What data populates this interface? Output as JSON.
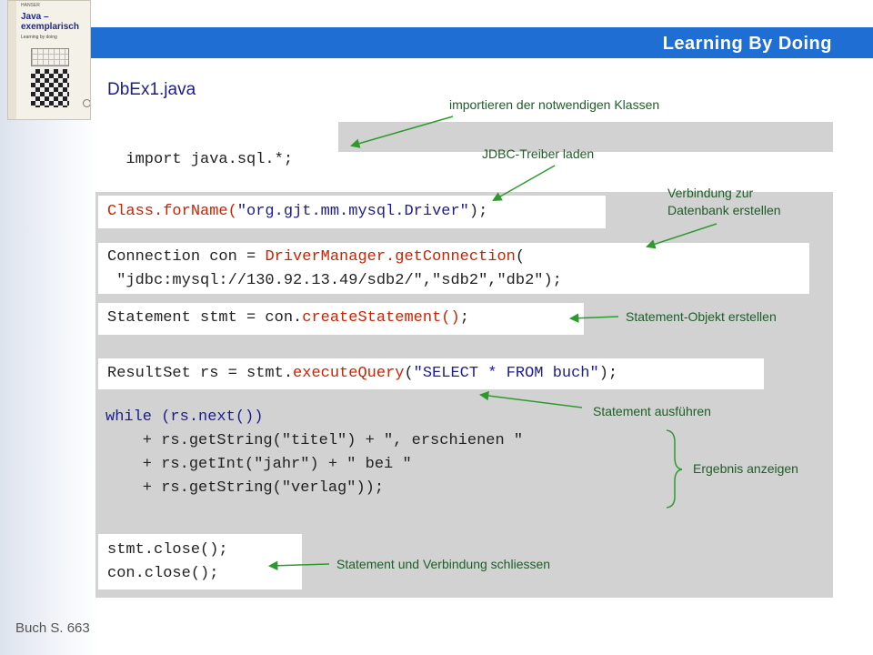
{
  "header": {
    "title": "Learning By Doing"
  },
  "book_cover": {
    "publisher": "HANSER",
    "title_line1": "Java –",
    "title_line2": "exemplarisch",
    "subtitle": "Learning by doing"
  },
  "file_name": "DbEx1.java",
  "code": {
    "import_line": "import java.sql.*;",
    "forname_prefix": "Class.forName(",
    "forname_string": "\"org.gjt.mm.mysql.Driver\"",
    "forname_suffix": ");",
    "conn_prefix": "Connection con = ",
    "conn_call": "DriverManager.getConnection",
    "conn_paren": "(",
    "conn_args": " \"jdbc:mysql://130.92.13.49/sdb2/\",\"sdb2\",\"db2\");",
    "stmt_prefix": "Statement stmt = con.",
    "stmt_call": "createStatement()",
    "stmt_suffix": ";",
    "rs_prefix": "ResultSet rs = stmt.",
    "rs_call": "executeQuery",
    "rs_open": "(",
    "rs_query": "\"SELECT * FROM buch\"",
    "rs_close": ");",
    "while_line": "while (rs.next())",
    "print_line1": "    + rs.getString(\"titel\") + \", erschienen \"",
    "print_line2": "    + rs.getInt(\"jahr\") + \" bei \"",
    "print_line3": "    + rs.getString(\"verlag\"));",
    "close_stmt": "stmt.close();",
    "close_con": "con.close();"
  },
  "annotations": {
    "imports": "importieren der notwendigen Klassen",
    "load_driver": "JDBC-Treiber laden",
    "connection_line1": "Verbindung zur",
    "connection_line2": "Datenbank erstellen",
    "statement": "Statement-Objekt erstellen",
    "execute": "Statement ausführen",
    "result": "Ergebnis anzeigen",
    "close": "Statement und Verbindung schliessen"
  },
  "footer": {
    "reference": "Buch S. 663"
  },
  "colors": {
    "accent_bar": "#1f6ed4",
    "keyword": "#cc2200",
    "string": "#1c1c8c",
    "annotation": "#1d5e26",
    "arrow": "#2e9a2e",
    "panel": "#d2d2d2"
  }
}
